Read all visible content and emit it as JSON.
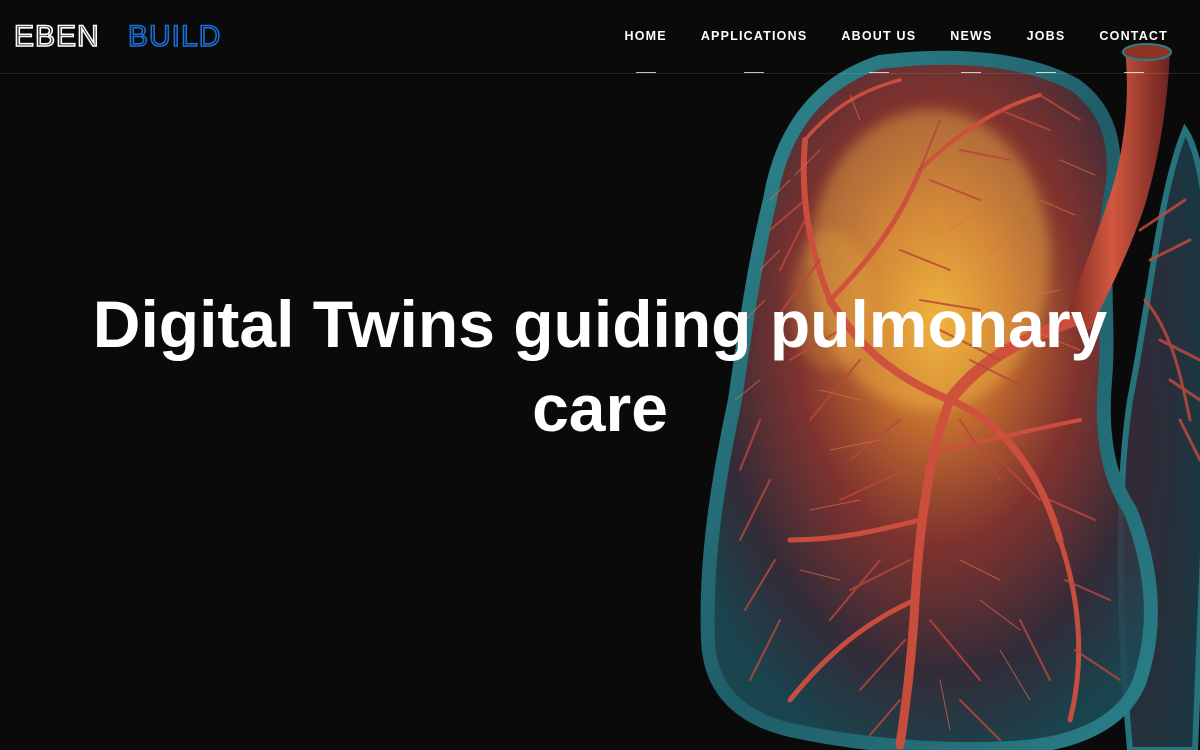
{
  "brand": {
    "logo_part1": "EBEN",
    "logo_part2": "BUILD",
    "logo_color_primary": "#ffffff",
    "logo_color_accent": "#1a6fd6"
  },
  "nav": {
    "items": [
      {
        "label": "HOME"
      },
      {
        "label": "APPLICATIONS"
      },
      {
        "label": "ABOUT US"
      },
      {
        "label": "NEWS"
      },
      {
        "label": "JOBS"
      },
      {
        "label": "CONTACT"
      }
    ]
  },
  "hero": {
    "title": "Digital Twins guiding pulmonary care",
    "image": "lung-illustration"
  },
  "colors": {
    "background": "#0a0a0b",
    "text": "#ffffff",
    "lung_edge": "#1f6f78",
    "airway": "#c84a3c",
    "glow": "#f2b544"
  }
}
